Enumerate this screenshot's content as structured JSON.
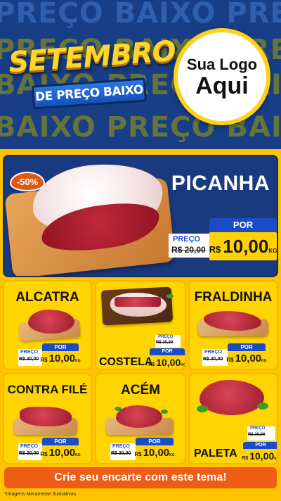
{
  "header": {
    "background_words": [
      "PREÇO BAIXO PREÇO",
      "PREÇO BAIXO PREÇO",
      "BAIXO PREÇO BAIXO",
      "BAIXO PREÇO BAIXO"
    ],
    "campaign_title": "SETEMBRO",
    "campaign_subtitle": "DE PREÇO BAIXO",
    "logo_line1": "Sua Logo",
    "logo_line2": "Aqui"
  },
  "hero": {
    "badge": "-50%",
    "name": "PICANHA",
    "preco_label": "PREÇO",
    "old_price": "R$ 20,00",
    "por_label": "POR",
    "currency": "R$",
    "price": "10,00",
    "unit": "KG"
  },
  "products": [
    {
      "name": "ALCATRA",
      "preco_label": "PREÇO",
      "old_price": "R$ 20,00",
      "por_label": "POR",
      "currency": "R$",
      "price": "10,00",
      "unit": "KG"
    },
    {
      "name": "COSTELA",
      "preco_label": "PREÇO",
      "old_price": "R$ 20,00",
      "por_label": "POR",
      "currency": "R$",
      "price": "10,00",
      "unit": "KG"
    },
    {
      "name": "FRALDINHA",
      "preco_label": "PREÇO",
      "old_price": "R$ 20,00",
      "por_label": "POR",
      "currency": "R$",
      "price": "10,00",
      "unit": "KG"
    },
    {
      "name": "CONTRA FILÉ",
      "preco_label": "PREÇO",
      "old_price": "R$ 20,00",
      "por_label": "POR",
      "currency": "R$",
      "price": "10,00",
      "unit": "KG"
    },
    {
      "name": "ACÉM",
      "preco_label": "PREÇO",
      "old_price": "R$ 20,00",
      "por_label": "POR",
      "currency": "R$",
      "price": "10,00",
      "unit": "KG"
    },
    {
      "name": "PALETA",
      "preco_label": "PREÇO",
      "old_price": "R$ 20,00",
      "por_label": "POR",
      "currency": "R$",
      "price": "10,00",
      "unit": "KG"
    }
  ],
  "cta": "Crie seu encarte com este tema!",
  "footnote": "*Imagens Meramente Ilustrativas"
}
